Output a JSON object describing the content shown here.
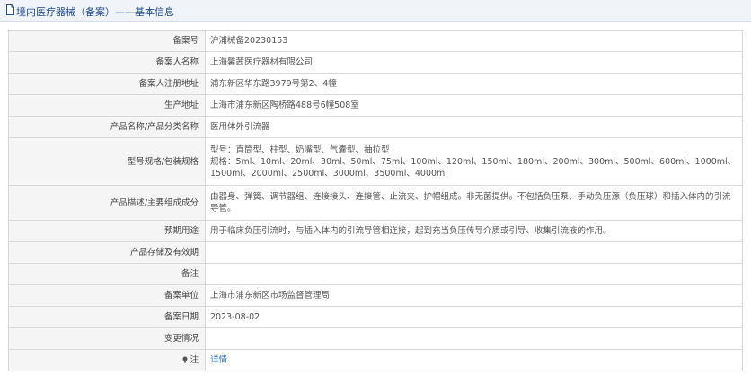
{
  "header": {
    "title": "境内医疗器械（备案）——基本信息"
  },
  "colors": {
    "header_bg": "#f0f3f8",
    "title": "#1f4f8f",
    "link": "#2a6fc9"
  },
  "rows": [
    {
      "label": "备案号",
      "value": "沪浦械备20230153"
    },
    {
      "label": "备案人名称",
      "value": "上海馨茜医疗器材有限公司"
    },
    {
      "label": "备案人注册地址",
      "value": "浦东新区华东路3979号第2、4幢"
    },
    {
      "label": "生产地址",
      "value": "上海市浦东新区陶桥路488号6幢508室"
    },
    {
      "label": "产品名称/产品分类名称",
      "value": "医用体外引流器"
    },
    {
      "label": "型号规格/包装规格",
      "value_line1": "型号：直筒型、柱型、奶嘴型、气囊型、抽拉型",
      "value_line2": "规格：5ml、10ml、20ml、30ml、50ml、75ml、100ml、120ml、150ml、180ml、200ml、300ml、500ml、600ml、1000ml、1500ml、2000ml、2500ml、3000ml、3500ml、4000ml"
    },
    {
      "label": "产品描述/主要组成成分",
      "value": "由器身、弹簧、调节器组、连接接头、连接管、止流夹、护帽组成。非无菌提供。不包括负压泵、手动负压源（负压球）和插入体内的引流导管。"
    },
    {
      "label": "预期用途",
      "value": "用于临床负压引流时，与插入体内的引流导管相连接，起到充当负压传导介质或引导、收集引流液的作用。"
    },
    {
      "label": "产品存储及有效期",
      "value": ""
    },
    {
      "label": "备注",
      "value": ""
    },
    {
      "label": "备案单位",
      "value": "上海市浦东新区市场监督管理局"
    },
    {
      "label": "备案日期",
      "value": "2023-08-02"
    },
    {
      "label": "变更情况",
      "value": ""
    },
    {
      "label": "注",
      "value": "详情",
      "icon": "tip-icon"
    }
  ]
}
